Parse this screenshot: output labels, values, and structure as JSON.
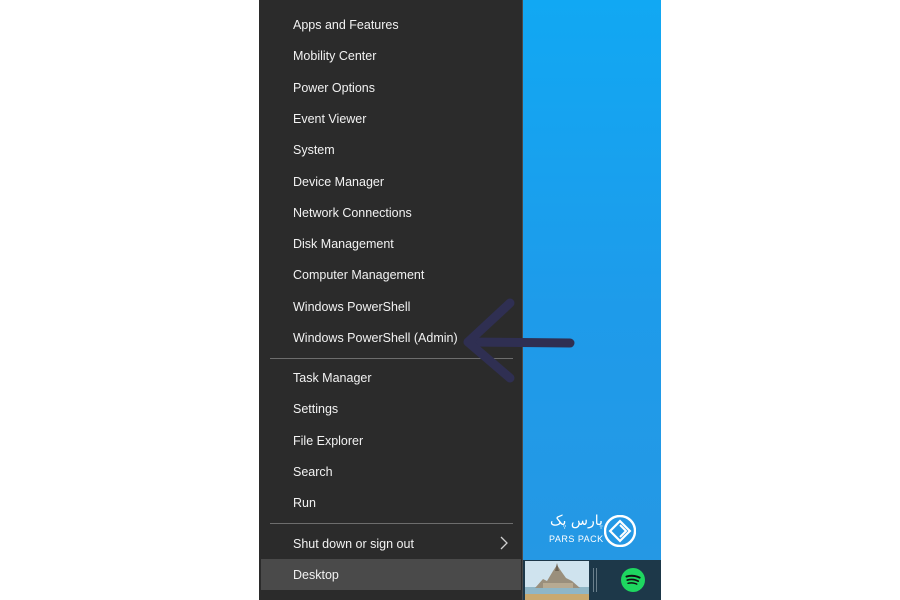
{
  "menu": {
    "group1": [
      {
        "label": "Apps and Features"
      },
      {
        "label": "Mobility Center"
      },
      {
        "label": "Power Options"
      },
      {
        "label": "Event Viewer"
      },
      {
        "label": "System"
      },
      {
        "label": "Device Manager"
      },
      {
        "label": "Network Connections"
      },
      {
        "label": "Disk Management"
      },
      {
        "label": "Computer Management"
      },
      {
        "label": "Windows PowerShell"
      },
      {
        "label": "Windows PowerShell (Admin)"
      }
    ],
    "group2": [
      {
        "label": "Task Manager"
      },
      {
        "label": "Settings"
      },
      {
        "label": "File Explorer"
      },
      {
        "label": "Search"
      },
      {
        "label": "Run"
      }
    ],
    "group3": [
      {
        "label": "Shut down or sign out",
        "has_submenu": true
      },
      {
        "label": "Desktop",
        "highlighted": true
      }
    ]
  },
  "brand": {
    "name_fa": "پارس پک",
    "name_en": "PARS PACK"
  },
  "annotation": {
    "arrow_color": "#2f2f52"
  },
  "taskbar": {
    "icons": [
      "castle-photo-thumbnail",
      "spotify-icon"
    ]
  },
  "colors": {
    "menu_bg": "#2b2b2b",
    "menu_text": "#f2f2f2",
    "highlight_bg": "#4a4a4a",
    "desktop_blue": "#16a0f0",
    "taskbar_bg": "#1d3849",
    "spotify_green": "#1ed760"
  }
}
